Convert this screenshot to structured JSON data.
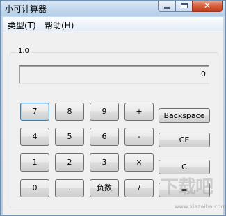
{
  "window": {
    "title": "小可计算器"
  },
  "menu": {
    "items": [
      "类型(T)",
      "帮助(H)"
    ]
  },
  "group": {
    "label": "1.0"
  },
  "display": {
    "value": "0"
  },
  "keypad": {
    "row1": [
      "7",
      "8",
      "9",
      "+"
    ],
    "row2": [
      "4",
      "5",
      "6",
      "-"
    ],
    "row3": [
      "1",
      "2",
      "3",
      "×"
    ],
    "row4": [
      "0",
      ".",
      "负数",
      "/"
    ]
  },
  "functions": {
    "backspace": "Backspace",
    "ce": "CE",
    "c": "C",
    "equals": "="
  },
  "watermark": {
    "text": "下载吧",
    "url": "www.xiazaiba.com"
  },
  "icons": {
    "minimize": "minimize-icon",
    "maximize": "maximize-icon",
    "close": "close-icon"
  }
}
